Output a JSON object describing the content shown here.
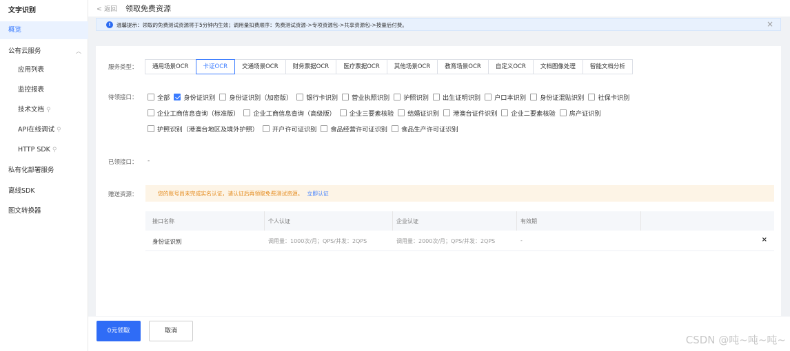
{
  "sidebar": {
    "title": "文字识别",
    "items": [
      {
        "label": "概览",
        "active": true
      },
      {
        "label": "公有云服务"
      },
      {
        "label": "应用列表"
      },
      {
        "label": "监控报表"
      },
      {
        "label": "技术文档"
      },
      {
        "label": "API在线调试"
      },
      {
        "label": "HTTP SDK"
      },
      {
        "label": "私有化部署服务"
      },
      {
        "label": "离线SDK"
      },
      {
        "label": "图文转换器"
      }
    ]
  },
  "header": {
    "back_label": "< 返回",
    "title": "领取免费资源"
  },
  "notice": {
    "text": "温馨提示：领取的免费测试资源将于5分钟内生效；调用量扣费顺序：免费测试资源->专项资源包->共享资源包->按量后付费。"
  },
  "form": {
    "service_type_label": "服务类型：",
    "tabs": [
      "通用场景OCR",
      "卡证OCR",
      "交通场景OCR",
      "财务票据OCR",
      "医疗票据OCR",
      "其他场景OCR",
      "教育场景OCR",
      "自定义OCR",
      "文档图像处理",
      "智能文档分析"
    ],
    "pending_label": "待领接口：",
    "apis_row1": [
      "全部",
      "身份证识别",
      "身份证识别（加密版）",
      "银行卡识别",
      "营业执照识别",
      "护照识别",
      "出生证明识别",
      "户口本识别",
      "身份证混贴识别",
      "社保卡识别"
    ],
    "apis_row2": [
      "企业工商信息查询（标准版）",
      "企业工商信息查询（高级版）",
      "企业三要素核验",
      "结婚证识别",
      "港澳台证件识别",
      "企业二要素核验",
      "房产证识别"
    ],
    "apis_row3": [
      "护照识别（港澳台地区及境外护照）",
      "开户许可证识别",
      "食品经营许可证识别",
      "食品生产许可证识别"
    ],
    "claimed_label": "已领接口：",
    "claimed_value": "-",
    "gift_label": "赠送资源：",
    "warning_text": "您的账号尚未完成实名认证，请认证后再领取免费测试资源。",
    "warning_link": "立即认证"
  },
  "table": {
    "headers": [
      "接口名称",
      "个人认证",
      "企业认证",
      "有效期"
    ],
    "rows": [
      {
        "name": "身份证识别",
        "personal": "调用量：1000次/月；QPS/并发：2QPS",
        "enterprise": "调用量：2000次/月；QPS/并发：2QPS",
        "validity": "-",
        "remove": "×"
      }
    ]
  },
  "footer": {
    "confirm_label": "0元领取",
    "cancel_label": "取消"
  },
  "watermark": "CSDN @吨~吨~吨~"
}
